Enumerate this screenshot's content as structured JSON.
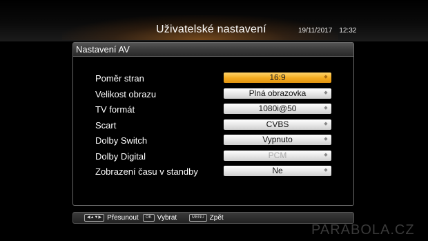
{
  "header": {
    "title": "Uživatelské nastavení",
    "date": "19/11/2017",
    "time": "12:32"
  },
  "panel": {
    "title": "Nastavení AV"
  },
  "settings": [
    {
      "label": "Poměr stran",
      "value": "16:9",
      "state": "selected"
    },
    {
      "label": "Velikost obrazu",
      "value": "Plná obrazovka",
      "state": "normal"
    },
    {
      "label": "TV formát",
      "value": "1080i@50",
      "state": "normal"
    },
    {
      "label": "Scart",
      "value": "CVBS",
      "state": "normal"
    },
    {
      "label": "Dolby Switch",
      "value": "Vypnuto",
      "state": "normal"
    },
    {
      "label": "Dolby Digital",
      "value": "PCM",
      "state": "disabled"
    },
    {
      "label": "Zobrazení času v standby",
      "value": "Ne",
      "state": "normal"
    }
  ],
  "footer": {
    "move": {
      "key": "◀▲▼▶",
      "label": "Přesunout"
    },
    "select": {
      "key": "OK",
      "label": "Vybrat"
    },
    "back": {
      "key": "MENU",
      "label": "Zpět"
    }
  },
  "watermark": "PARABOLA.CZ",
  "colors": {
    "selected": "#f3aa1e",
    "panel_border": "#6a6a6a",
    "background": "#000000"
  },
  "icons": {
    "dropdown": "select-arrows-icon"
  }
}
